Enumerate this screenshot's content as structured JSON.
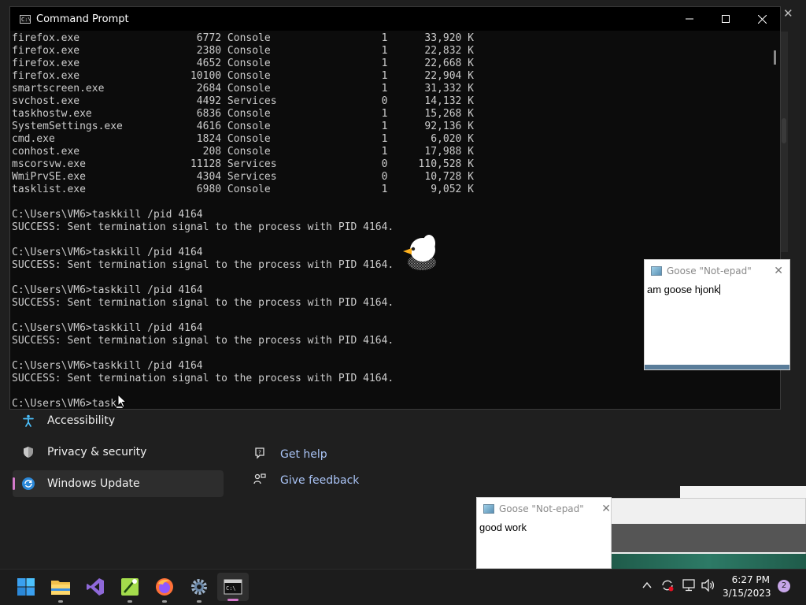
{
  "settings": {
    "nav": [
      {
        "label": "Accessibility",
        "icon": "accessibility-icon"
      },
      {
        "label": "Privacy & security",
        "icon": "shield-icon"
      },
      {
        "label": "Windows Update",
        "icon": "windows-update-icon",
        "active": true
      }
    ],
    "links": [
      {
        "label": "Get help",
        "icon": "help-icon"
      },
      {
        "label": "Give feedback",
        "icon": "feedback-icon"
      }
    ]
  },
  "cmd": {
    "title": "Command Prompt",
    "process_rows": [
      {
        "name": "firefox.exe",
        "pid": "6772",
        "session": "Console",
        "num": "1",
        "mem": "33,920 K"
      },
      {
        "name": "firefox.exe",
        "pid": "2380",
        "session": "Console",
        "num": "1",
        "mem": "22,832 K"
      },
      {
        "name": "firefox.exe",
        "pid": "4652",
        "session": "Console",
        "num": "1",
        "mem": "22,668 K"
      },
      {
        "name": "firefox.exe",
        "pid": "10100",
        "session": "Console",
        "num": "1",
        "mem": "22,904 K"
      },
      {
        "name": "smartscreen.exe",
        "pid": "2684",
        "session": "Console",
        "num": "1",
        "mem": "31,332 K"
      },
      {
        "name": "svchost.exe",
        "pid": "4492",
        "session": "Services",
        "num": "0",
        "mem": "14,132 K"
      },
      {
        "name": "taskhostw.exe",
        "pid": "6836",
        "session": "Console",
        "num": "1",
        "mem": "15,268 K"
      },
      {
        "name": "SystemSettings.exe",
        "pid": "4616",
        "session": "Console",
        "num": "1",
        "mem": "92,136 K"
      },
      {
        "name": "cmd.exe",
        "pid": "1824",
        "session": "Console",
        "num": "1",
        "mem": "6,020 K"
      },
      {
        "name": "conhost.exe",
        "pid": "208",
        "session": "Console",
        "num": "1",
        "mem": "17,988 K"
      },
      {
        "name": "mscorsvw.exe",
        "pid": "11128",
        "session": "Services",
        "num": "0",
        "mem": "110,528 K"
      },
      {
        "name": "WmiPrvSE.exe",
        "pid": "4304",
        "session": "Services",
        "num": "0",
        "mem": "10,728 K"
      },
      {
        "name": "tasklist.exe",
        "pid": "6980",
        "session": "Console",
        "num": "1",
        "mem": "9,052 K"
      }
    ],
    "commands": [
      {
        "prompt": "C:\\Users\\VM6>",
        "command": "taskkill /pid 4164",
        "output": "SUCCESS: Sent termination signal to the process with PID 4164."
      },
      {
        "prompt": "C:\\Users\\VM6>",
        "command": "taskkill /pid 4164",
        "output": "SUCCESS: Sent termination signal to the process with PID 4164."
      },
      {
        "prompt": "C:\\Users\\VM6>",
        "command": "taskkill /pid 4164",
        "output": "SUCCESS: Sent termination signal to the process with PID 4164."
      },
      {
        "prompt": "C:\\Users\\VM6>",
        "command": "taskkill /pid 4164",
        "output": "SUCCESS: Sent termination signal to the process with PID 4164."
      },
      {
        "prompt": "C:\\Users\\VM6>",
        "command": "taskkill /pid 4164",
        "output": "SUCCESS: Sent termination signal to the process with PID 4164."
      }
    ],
    "current_prompt": "C:\\Users\\VM6>",
    "current_input": "task"
  },
  "notepad1": {
    "title": "Goose \"Not-epad\"",
    "text": "am goose hjonk"
  },
  "notepad2": {
    "title": "Goose \"Not-epad\"",
    "text": "good work"
  },
  "taskbar": {
    "apps": [
      "start-icon",
      "file-explorer-icon",
      "visual-studio-icon",
      "notepad-plus-icon",
      "firefox-icon",
      "settings-icon",
      "terminal-icon"
    ],
    "clock_time": "6:27 PM",
    "clock_date": "3/15/2023",
    "notification_count": "2"
  },
  "colors": {
    "accent": "#d47acb",
    "link": "#a9c3f5",
    "console_bg": "#0c0c0c",
    "console_fg": "#cccccc"
  }
}
